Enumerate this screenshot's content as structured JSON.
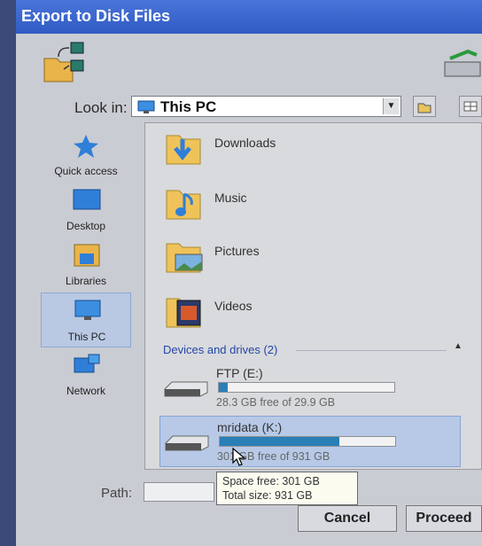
{
  "window": {
    "title": "Export to Disk Files"
  },
  "lookin": {
    "label": "Look in:",
    "value": "This PC"
  },
  "places": [
    {
      "label": "Quick access",
      "icon": "star-icon"
    },
    {
      "label": "Desktop",
      "icon": "desktop-icon"
    },
    {
      "label": "Libraries",
      "icon": "libraries-icon"
    },
    {
      "label": "This PC",
      "icon": "pc-icon"
    },
    {
      "label": "Network",
      "icon": "network-icon"
    }
  ],
  "folders": [
    {
      "name": "Downloads",
      "icon": "downloads-folder-icon"
    },
    {
      "name": "Music",
      "icon": "music-folder-icon"
    },
    {
      "name": "Pictures",
      "icon": "pictures-folder-icon"
    },
    {
      "name": "Videos",
      "icon": "videos-folder-icon"
    }
  ],
  "devices": {
    "header": "Devices and drives (2)",
    "drives": [
      {
        "name": "FTP (E:)",
        "free_text": "28.3 GB free of 29.9 GB",
        "used_fraction": 0.05
      },
      {
        "name": "mridata (K:)",
        "free_text": "301 GB free of 931 GB",
        "used_fraction": 0.68
      }
    ]
  },
  "tooltip": {
    "line1": "Space free: 301 GB",
    "line2": "Total size: 931 GB"
  },
  "path": {
    "label": "Path:",
    "value": ""
  },
  "buttons": {
    "cancel": "Cancel",
    "proceed": "Proceed"
  },
  "colors": {
    "title_bar": "#2f5bc4",
    "usage_bar": "#2a7fb7",
    "selection": "#b7c9e6"
  }
}
